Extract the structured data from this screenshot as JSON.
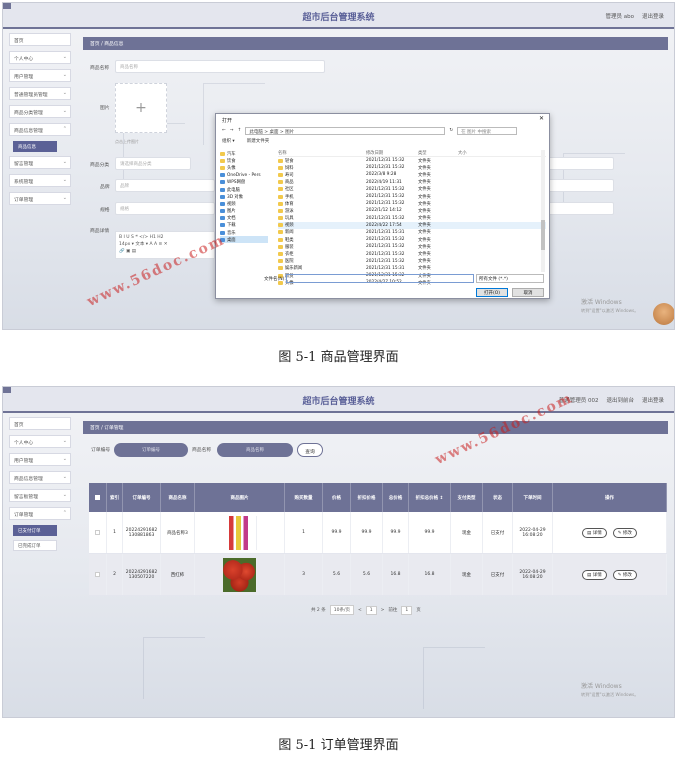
{
  "screen1": {
    "app_title": "超市后台管理系统",
    "header_right": [
      "管理员 abo",
      "退出登录"
    ],
    "sidebar": [
      {
        "label": "首页",
        "chevron": false
      },
      {
        "label": "个人中心",
        "chevron": true
      },
      {
        "label": "用户管理",
        "chevron": true
      },
      {
        "label": "普通管理员管理",
        "chevron": true
      },
      {
        "label": "商品分类管理",
        "chevron": true
      },
      {
        "label": "商品信息管理",
        "chevron": true
      }
    ],
    "sidebar_active_sub": "商品信息",
    "sidebar_rest": [
      {
        "label": "留言管理",
        "chevron": true
      },
      {
        "label": "系统管理",
        "chevron": true
      },
      {
        "label": "订单管理",
        "chevron": true
      }
    ],
    "breadcrumb": "首页  /  商品信息",
    "form": {
      "name_label": "商品名称",
      "name_placeholder": "商品名称",
      "image_label": "图片",
      "upload_plus": "+",
      "upload_hint": "点击上传图片",
      "category_label": "商品分类",
      "category_placeholder": "请选择商品分类",
      "brand_label": "品牌",
      "brand_placeholder": "品牌",
      "spec_label": "规格",
      "spec_placeholder": "规格",
      "detail_label": "商品详情",
      "editor_toolbar": "B  I  U  S  ❝  </>  H1  H2",
      "editor_toolbar2": "14px  ▾  文本  ▾  A  A  ≡  ✕",
      "editor_toolbar3": "🔗  ▣  ▤"
    },
    "dialog": {
      "title": "打开",
      "path": "此电脑  >  桌面  >  图片",
      "search": "在 图片 中搜索",
      "organize": "组织 ▾",
      "new_folder": "新建文件夹",
      "tree": [
        {
          "label": "汽车",
          "blue": false
        },
        {
          "label": "饮食",
          "blue": false
        },
        {
          "label": "头像",
          "blue": false
        },
        {
          "label": "OneDrive - Pers",
          "blue": true
        },
        {
          "label": "WPS网盘",
          "blue": true
        },
        {
          "label": "此电脑",
          "blue": true
        },
        {
          "label": "3D 对象",
          "blue": true
        },
        {
          "label": "视频",
          "blue": true
        },
        {
          "label": "图片",
          "blue": true
        },
        {
          "label": "文档",
          "blue": true
        },
        {
          "label": "下载",
          "blue": true
        },
        {
          "label": "音乐",
          "blue": true
        },
        {
          "label": "桌面",
          "blue": true
        }
      ],
      "col_headers": [
        "名称",
        "修改日期",
        "类型",
        "大小"
      ],
      "files": [
        {
          "name": "轻食",
          "date": "2021/12/31 15:32",
          "type": "文件夹"
        },
        {
          "name": "饲料",
          "date": "2021/12/31 15:32",
          "type": "文件夹"
        },
        {
          "name": "寿司",
          "date": "2022/3/8 9:28",
          "type": "文件夹"
        },
        {
          "name": "商品",
          "date": "2022/4/19 11:31",
          "type": "文件夹"
        },
        {
          "name": "社区",
          "date": "2021/12/31 15:32",
          "type": "文件夹"
        },
        {
          "name": "手机",
          "date": "2021/12/31 15:32",
          "type": "文件夹"
        },
        {
          "name": "体育",
          "date": "2021/12/31 15:32",
          "type": "文件夹"
        },
        {
          "name": "游泳",
          "date": "2022/1/12 14:12",
          "type": "文件夹"
        },
        {
          "name": "玩具",
          "date": "2021/12/31 15:32",
          "type": "文件夹"
        },
        {
          "name": "视频",
          "date": "2022/4/22 17:54",
          "type": "文件夹"
        },
        {
          "name": "新闻",
          "date": "2021/12/31 15:31",
          "type": "文件夹"
        },
        {
          "name": "鞋类",
          "date": "2021/12/31 15:32",
          "type": "文件夹"
        },
        {
          "name": "服装",
          "date": "2021/12/31 15:32",
          "type": "文件夹"
        },
        {
          "name": "衣柜",
          "date": "2021/12/31 15:32",
          "type": "文件夹"
        },
        {
          "name": "医院",
          "date": "2021/12/31 15:32",
          "type": "文件夹"
        },
        {
          "name": "娱乐新闻",
          "date": "2021/12/31 15:31",
          "type": "文件夹"
        },
        {
          "name": "职员",
          "date": "2021/12/31 15:32",
          "type": "文件夹"
        },
        {
          "name": "头像",
          "date": "2022/4/27 10:52",
          "type": "文件夹"
        }
      ],
      "filename_label": "文件名(N):",
      "filetype": "所有文件 (*.*)",
      "open_btn": "打开(O)",
      "cancel_btn": "取消"
    },
    "activate": "激活 Windows",
    "activate_sub": "转到\"设置\"以激活 Windows。",
    "watermark": "www.56doc.com",
    "caption": "图 5-1  商品管理界面"
  },
  "screen2": {
    "app_title": "超市后台管理系统",
    "header_right": [
      "普通管理员 002",
      "退出到前台",
      "退出登录"
    ],
    "sidebar": [
      {
        "label": "首页",
        "chevron": false
      },
      {
        "label": "个人中心",
        "chevron": true
      },
      {
        "label": "用户管理",
        "chevron": true
      },
      {
        "label": "商品信息管理",
        "chevron": true
      },
      {
        "label": "留言板管理",
        "chevron": true
      },
      {
        "label": "订单管理",
        "chevron": true
      }
    ],
    "sidebar_subs": [
      "已支付订单",
      "已完成订单"
    ],
    "breadcrumb": "首页  /  订单管理",
    "filters": {
      "order_label": "订单编号",
      "order_placeholder": "订单编号",
      "product_label": "商品名称",
      "product_placeholder": "商品名称",
      "query_btn": "查询"
    },
    "columns": [
      "",
      "索引",
      "订单编号",
      "商品名称",
      "商品图片",
      "购买数量",
      "价格",
      "折扣价格",
      "总价格",
      "折扣总价格 ↕",
      "支付类型",
      "状态",
      "下单时间",
      "操作"
    ],
    "rows": [
      {
        "index": "1",
        "order_no": "20224291682\n130881863",
        "product": "商品名称3",
        "qty": "1",
        "price": "99.9",
        "disc_price": "99.9",
        "total": "99.9",
        "disc_total": "99.9",
        "pay": "现金",
        "status": "已支付",
        "time": "2022-04-29\n16:08:20"
      },
      {
        "index": "2",
        "order_no": "20224291682\n130507220",
        "product": "西红柿",
        "qty": "3",
        "price": "5.6",
        "disc_price": "5.6",
        "total": "16.8",
        "disc_total": "16.8",
        "pay": "现金",
        "status": "已支付",
        "time": "2022-04-29\n16:08:20"
      }
    ],
    "detail_btn": "▤ 详情",
    "edit_btn": "✎ 修改",
    "pager": {
      "total": "共 2 条",
      "page_size": "10条/页",
      "prev": "<",
      "page": "1",
      "next": ">",
      "goto": "前往",
      "goto_page": "1",
      "page_unit": "页"
    },
    "activate": "激活 Windows",
    "activate_sub": "转到\"设置\"以激活 Windows。",
    "watermark": "www.56doc.com",
    "caption": "图 5-1  订单管理界面"
  },
  "colors": {
    "accent": "#6e7296",
    "title": "#5a6098",
    "watermark": "#c81e1e"
  }
}
